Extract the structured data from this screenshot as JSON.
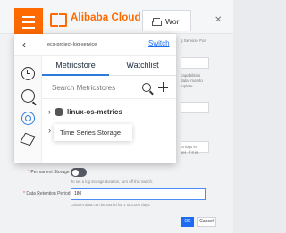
{
  "header": {
    "brand": "Alibaba Cloud",
    "workspace_tab": "Wor",
    "close": "✕"
  },
  "background": {
    "right_snippets": [
      "g Service. For",
      "capabilities",
      "data, monito",
      "mplete",
      "ot logs in",
      "se). If it is"
    ],
    "permanent_storage_label": "Permanent Storage",
    "permanent_storage_help": "To set a log storage duration, turn off this switch.",
    "retention_label": "Data Retention Period",
    "retention_value": "180",
    "retention_help": "Custom data can be stored for 1 to 3,000 days.",
    "ok_label": "OK",
    "cancel_label": "Cancel"
  },
  "popup": {
    "back_glyph": "‹",
    "project_name": "ecs-project-log-service",
    "switch_label": "Switch",
    "tabs": [
      {
        "label": "Metricstore",
        "active": true
      },
      {
        "label": "Watchlist",
        "active": false
      }
    ],
    "search_placeholder": "Search Metricstores",
    "tree": [
      {
        "label": "linux-os-metrics",
        "icon": "database-icon"
      }
    ],
    "tooltip": "Time Series Storage"
  },
  "rail_icons": [
    "clock-icon",
    "query-search-icon",
    "metrics-lens-icon",
    "cube-icon"
  ],
  "colors": {
    "accent": "#ff6a00",
    "primary": "#1d6bf3",
    "tab_underline": "#2d7bd6"
  }
}
